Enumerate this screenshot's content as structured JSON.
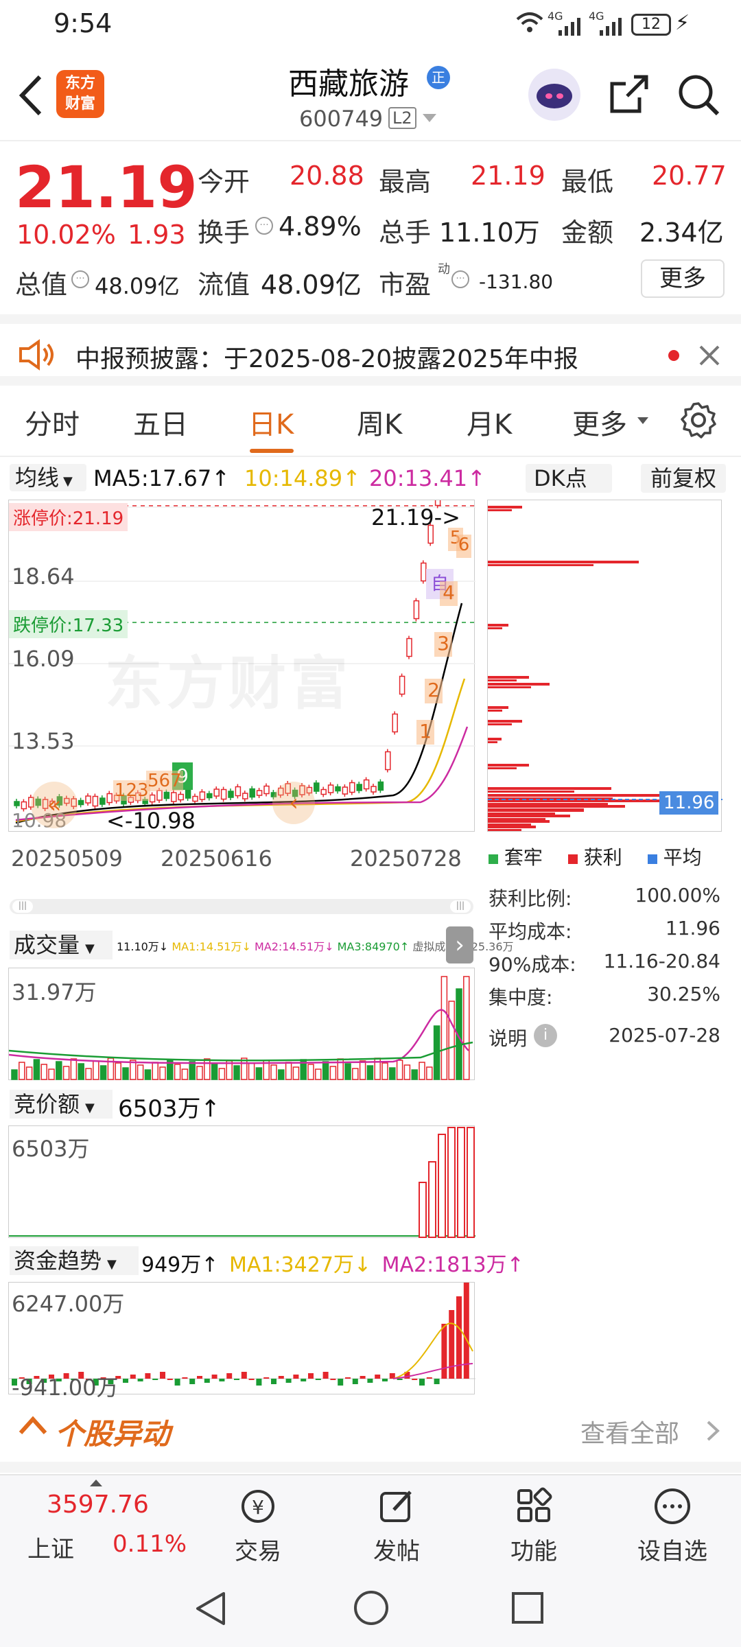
{
  "status_bar": {
    "time": "9:54",
    "signal1": "4G",
    "signal2": "4G",
    "battery": "12"
  },
  "header": {
    "title": "西藏旅游",
    "badge": "正",
    "code": "600749",
    "level": "L2",
    "logo_line1": "东方",
    "logo_line2": "财富"
  },
  "quote": {
    "price": "21.19",
    "change_pct": "10.02%",
    "change": "1.93",
    "open_label": "今开",
    "open": "20.88",
    "high_label": "最高",
    "high": "21.19",
    "low_label": "最低",
    "low": "20.77",
    "turnover_label": "换手",
    "turnover": "4.89%",
    "volume_label": "总手",
    "volume": "11.10万",
    "amount_label": "金额",
    "amount": "2.34亿",
    "mktcap_label": "总值",
    "mktcap": "48.09亿",
    "float_label": "流值",
    "float_cap": "48.09亿",
    "pe_label": "市盈",
    "pe_sup": "动",
    "pe": "-131.80",
    "more": "更多"
  },
  "notice": {
    "text": "中报预披露：于2025-08-20披露2025年中报"
  },
  "tabs": [
    "分时",
    "五日",
    "日K",
    "周K",
    "月K",
    "更多"
  ],
  "active_tab": "日K",
  "ma_row": {
    "selector": "均线",
    "ma5": "MA5:17.67↑",
    "ma10": "10:14.89↑",
    "ma20": "20:13.41↑",
    "dk": "DK点",
    "fq": "前复权"
  },
  "kchart": {
    "limit_up": "涨停价:21.19",
    "limit_down": "跌停价:17.33",
    "y_labels": [
      "18.64",
      "16.09",
      "13.53"
    ],
    "latest": "21.19->",
    "low_mark": "<-10.98",
    "low_left": "10.98",
    "dates": [
      "20250509",
      "20250616",
      "20250728"
    ],
    "markers": [
      "1",
      "2",
      "3",
      "4",
      "5",
      "6",
      "自",
      "9",
      "123",
      "567"
    ],
    "watermark": "东方财富"
  },
  "chip": {
    "avg_value": "11.96",
    "legend": [
      "套牢",
      "获利",
      "平均"
    ],
    "rows": [
      {
        "label": "获利比例:",
        "value": "100.00%"
      },
      {
        "label": "平均成本:",
        "value": "11.96"
      },
      {
        "label": "90%成本:",
        "value": "11.16-20.84"
      },
      {
        "label": "集中度:",
        "value": "30.25%"
      }
    ],
    "note_label": "说明",
    "date": "2025-07-28"
  },
  "volume_panel": {
    "selector": "成交量",
    "info": "11.10万↓",
    "ma1": "MA1:14.51万↓",
    "ma2": "MA2:14.51万↓",
    "ma3": "MA3:84970↑",
    "virtual": "虚拟成交量:25.36万",
    "top": "31.97万"
  },
  "auction_panel": {
    "selector": "竞价额",
    "value": "6503万↑",
    "top": "6503万"
  },
  "fund_panel": {
    "selector": "资金趋势",
    "value": "949万↑",
    "ma1": "MA1:3427万↓",
    "ma2": "MA2:1813万↑",
    "top": "6247.00万",
    "bottom": "-941.00万"
  },
  "abnormal": {
    "title": "个股异动",
    "view_all": "查看全部"
  },
  "bottom_nav": {
    "index_name": "上证",
    "index_value": "3597.76",
    "index_pct": "0.11%",
    "items": [
      "交易",
      "发帖",
      "功能",
      "设自选"
    ]
  },
  "colors": {
    "up": "#e4262c",
    "down": "#1a9c34",
    "accent": "#e06a1c",
    "ma5": "#000000",
    "ma10": "#e6b800",
    "ma20": "#cc2aa0"
  }
}
